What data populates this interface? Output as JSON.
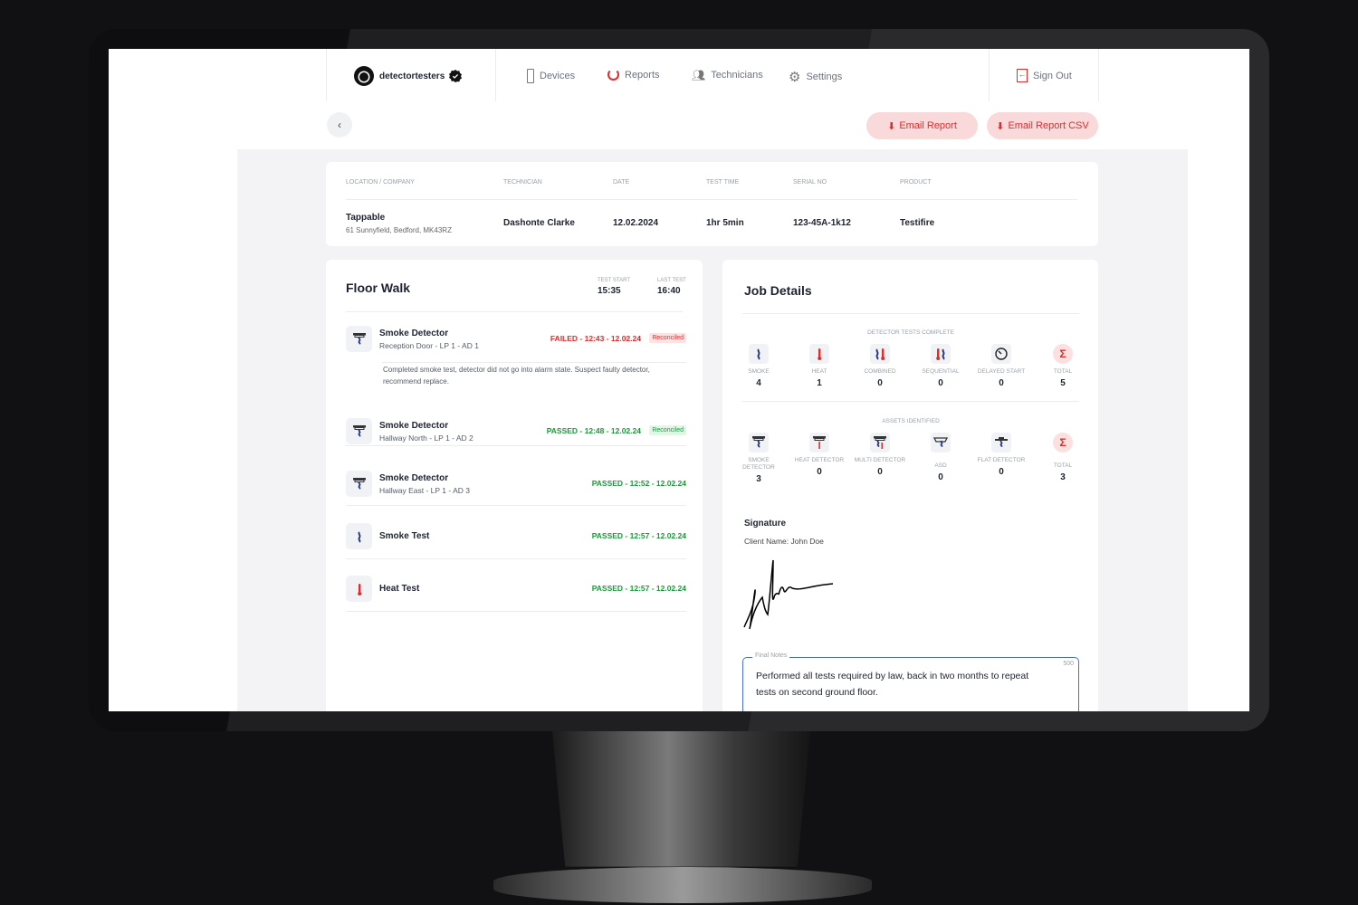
{
  "brand": {
    "name": "detectortesters"
  },
  "nav": [
    {
      "label": "Devices",
      "icon": "detector-icon"
    },
    {
      "label": "Reports",
      "icon": "reports-ring-icon"
    },
    {
      "label": "Technicians",
      "icon": "people-icon"
    },
    {
      "label": "Settings",
      "icon": "gear-icon"
    }
  ],
  "signout": "Sign Out",
  "actions": {
    "email_report": "Email Report",
    "email_csv": "Email Report CSV"
  },
  "colors": {
    "accent": "#e02b2b",
    "pass": "#1a9a3a",
    "fail": "#e02b2b",
    "navy": "#1f2f7a"
  },
  "info": {
    "headers": [
      "Location / Company",
      "Technician",
      "Date",
      "Test Time",
      "Serial No",
      "Product"
    ],
    "company": "Tappable",
    "address": "61 Sunnyfield, Bedford, MK43RZ",
    "technician": "Dashonte Clarke",
    "date": "12.02.2024",
    "test_time": "1hr 5min",
    "serial": "123-45A-1k12",
    "product": "Testifire"
  },
  "floor_walk": {
    "title": "Floor Walk",
    "test_start_label": "Test Start",
    "test_start": "15:35",
    "last_test_label": "Last Test",
    "last_test": "16:40",
    "rows": [
      {
        "title": "Smoke Detector",
        "sub": "Reception Door  -  LP 1 - AD 1",
        "status": "FAILED - 12:43 - 12.02.24",
        "result": "fail",
        "badge": "Reconciled",
        "note": "Completed smoke test, detector did not go into alarm state. Suspect faulty detector, recommend replace.",
        "icon": "smoke-detector-icon"
      },
      {
        "title": "Smoke Detector",
        "sub": "Hallway North  -  LP 1 - AD 2",
        "status": "PASSED - 12:48 - 12.02.24",
        "result": "pass",
        "badge": "Reconciled",
        "icon": "smoke-detector-icon"
      },
      {
        "title": "Smoke Detector",
        "sub": "Hallway East  -  LP 1 - AD 3",
        "status": "PASSED - 12:52 - 12.02.24",
        "result": "pass",
        "icon": "smoke-detector-icon"
      },
      {
        "title": "Smoke Test",
        "status": "PASSED - 12:57 - 12.02.24",
        "result": "pass",
        "icon": "smoke-icon"
      },
      {
        "title": "Heat Test",
        "status": "PASSED - 12:57 - 12.02.24",
        "result": "pass",
        "icon": "heat-icon"
      }
    ]
  },
  "job": {
    "title": "Job Details",
    "tests_label": "Detector Tests Complete",
    "tests": [
      {
        "label": "Smoke",
        "value": "4",
        "icon": "smoke-icon"
      },
      {
        "label": "Heat",
        "value": "1",
        "icon": "heat-icon"
      },
      {
        "label": "Combined",
        "value": "0",
        "icon": "combined-icon"
      },
      {
        "label": "Sequential",
        "value": "0",
        "icon": "sequential-icon"
      },
      {
        "label": "Delayed Start",
        "value": "0",
        "icon": "timer-icon"
      },
      {
        "label": "Total",
        "value": "5",
        "icon": "sigma-icon"
      }
    ],
    "assets_label": "Assets Identified",
    "assets": [
      {
        "label": "Smoke Detector",
        "value": "3",
        "icon": "smoke-detector-icon"
      },
      {
        "label": "Heat Detector",
        "value": "0",
        "icon": "heat-detector-icon"
      },
      {
        "label": "Multi Detector",
        "value": "0",
        "icon": "multi-detector-icon"
      },
      {
        "label": "ASD",
        "value": "0",
        "icon": "asd-icon"
      },
      {
        "label": "Flat Detector",
        "value": "0",
        "icon": "flat-detector-icon"
      },
      {
        "label": "Total",
        "value": "3",
        "icon": "sigma-icon"
      }
    ],
    "signature_title": "Signature",
    "client_name": "Client Name: John Doe",
    "notes_label": "Final Notes",
    "notes_limit": "500",
    "notes": "Performed all tests required by law, back in two months to repeat tests on second ground floor."
  }
}
